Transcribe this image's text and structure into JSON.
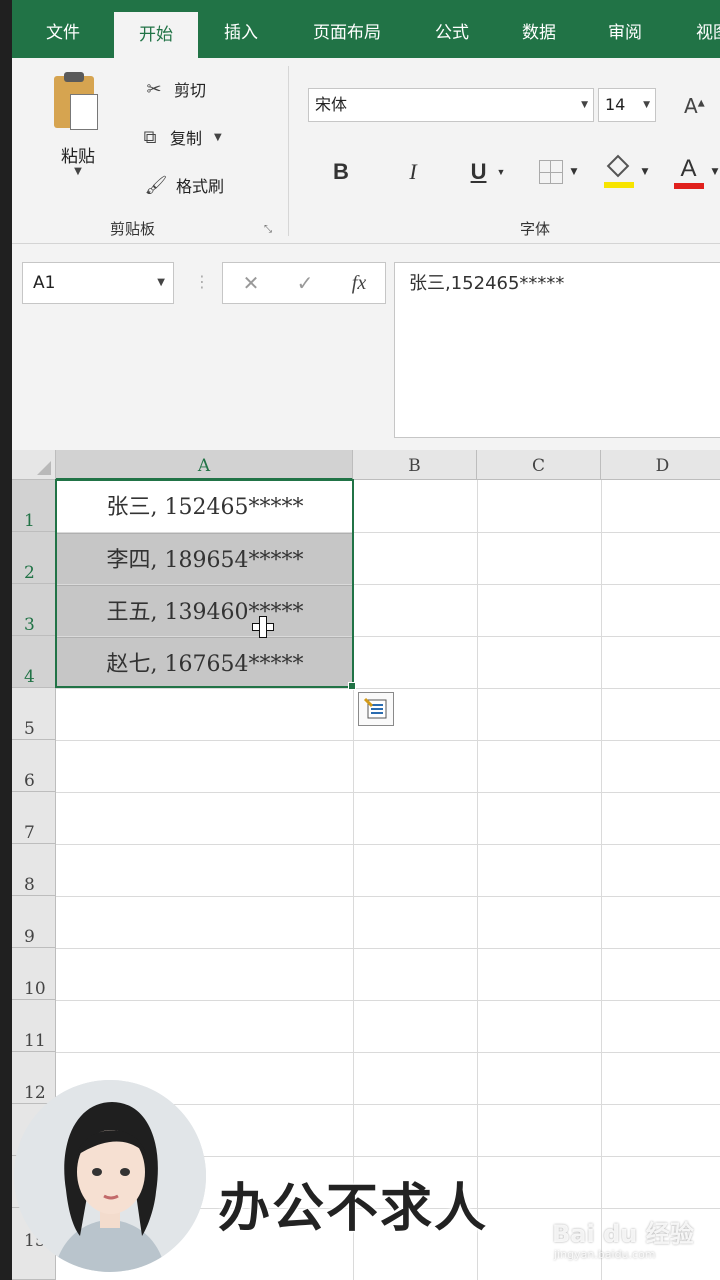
{
  "ribbon": {
    "tabs": [
      "文件",
      "开始",
      "插入",
      "页面布局",
      "公式",
      "数据",
      "审阅",
      "视图"
    ],
    "active_tab": "开始",
    "clipboard": {
      "paste_label": "粘贴",
      "cut_label": "剪切",
      "copy_label": "复制",
      "format_painter_label": "格式刷",
      "group_label": "剪贴板"
    },
    "font": {
      "font_name": "宋体",
      "font_size": "14",
      "bold_label": "B",
      "italic_label": "I",
      "underline_label": "U",
      "font_color_label": "A",
      "grow_font_label": "A",
      "group_label": "字体",
      "fill_color": "#f7e400",
      "font_color": "#e0201c"
    }
  },
  "formula_bar": {
    "name_box": "A1",
    "cancel_label": "✕",
    "enter_label": "✓",
    "fx_label": "fx",
    "content": "张三,152465*****"
  },
  "sheet": {
    "columns": [
      "A",
      "B",
      "C",
      "D"
    ],
    "rows": [
      "1",
      "2",
      "3",
      "4",
      "5",
      "6",
      "7",
      "8",
      "9",
      "10",
      "11",
      "12",
      "15"
    ],
    "cells": [
      "张三, 152465*****",
      "李四, 189654*****",
      "王五, 139460*****",
      "赵七, 167654*****"
    ]
  },
  "overlay": {
    "caption": "办公不求人",
    "watermark": "Bai du 经验",
    "watermark_sub": "jingyan.baidu.com"
  },
  "colors": {
    "excel_green": "#217346",
    "selection_shade": "#c6c6c6"
  }
}
